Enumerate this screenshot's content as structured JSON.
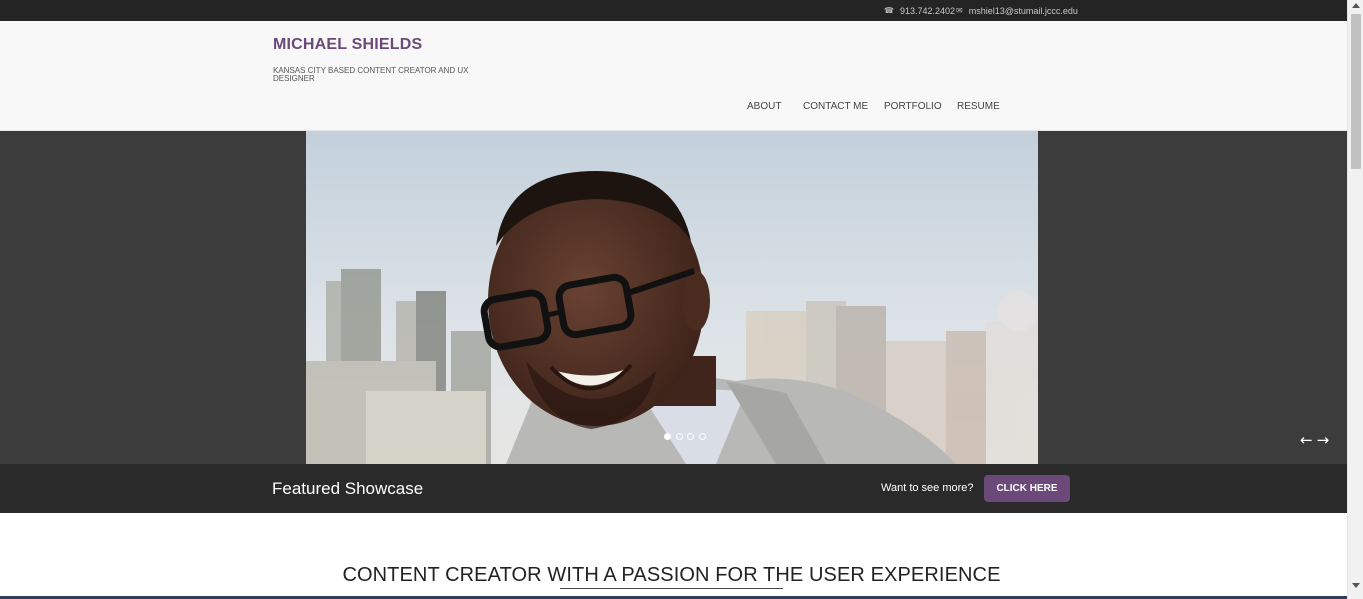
{
  "topbar": {
    "phone": "913.742.2402",
    "email": "mshiel13@stumail.jccc.edu",
    "phone_icon": "phone-icon",
    "email_icon": "envelope-icon"
  },
  "header": {
    "name": "MICHAEL SHIELDS",
    "tagline": "KANSAS CITY BASED CONTENT CREATOR AND UX DESIGNER",
    "nav": [
      "ABOUT",
      "CONTACT ME",
      "PORTFOLIO",
      "RESUME"
    ]
  },
  "slider": {
    "slide_count": 4,
    "active_index": 0,
    "prev_glyph": "←",
    "next_glyph": "→"
  },
  "featured": {
    "title": "Featured Showcase",
    "question": "Want to see more?",
    "cta_label": "CLICK HERE"
  },
  "main": {
    "headline": "CONTENT CREATOR WITH A PASSION FOR THE USER EXPERIENCE"
  },
  "colors": {
    "brand": "#6b4a79",
    "topbar": "#242424",
    "slider_bg": "#3c3c3c",
    "featured_bg": "#2a2a2a"
  }
}
